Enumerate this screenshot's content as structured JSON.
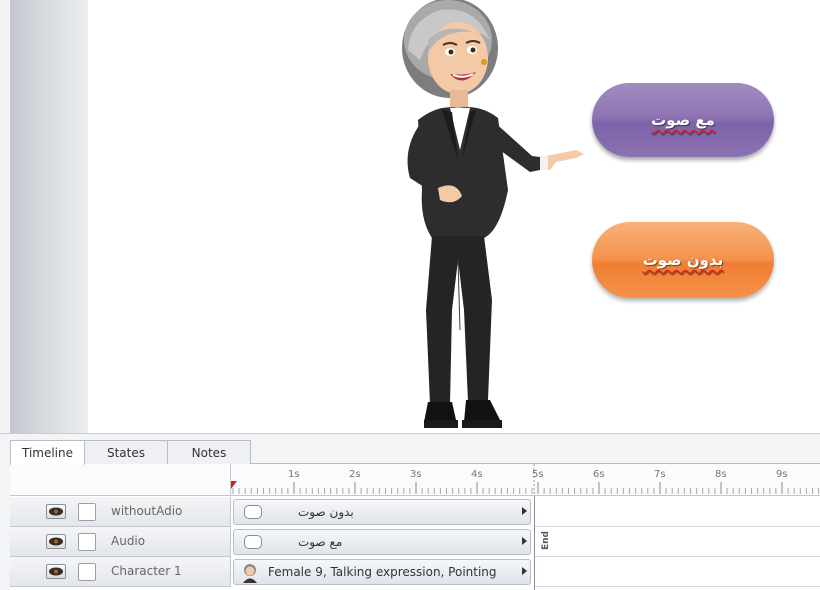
{
  "stage": {
    "buttons": {
      "with_sound": "مع صوت",
      "without_sound": "بدون صوت"
    },
    "colors": {
      "with_sound": "#8b72b2",
      "without_sound": "#f4934d"
    }
  },
  "panel": {
    "tabs": [
      {
        "label": "Timeline",
        "active": true
      },
      {
        "label": "States",
        "active": false
      },
      {
        "label": "Notes",
        "active": false
      }
    ],
    "ruler": {
      "ticks": [
        "1s",
        "2s",
        "3s",
        "4s",
        "5s",
        "6s",
        "7s",
        "8s",
        "9s"
      ],
      "end_label": "End"
    },
    "rows": [
      {
        "name": "withoutAdio",
        "bar_label": "بدون صوت",
        "icon": "button-shape-icon"
      },
      {
        "name": "Audio",
        "bar_label": "مع صوت",
        "icon": "button-shape-icon"
      },
      {
        "name": "Character 1",
        "bar_label": "Female 9, Talking expression, Pointing",
        "icon": "character-icon"
      }
    ]
  }
}
